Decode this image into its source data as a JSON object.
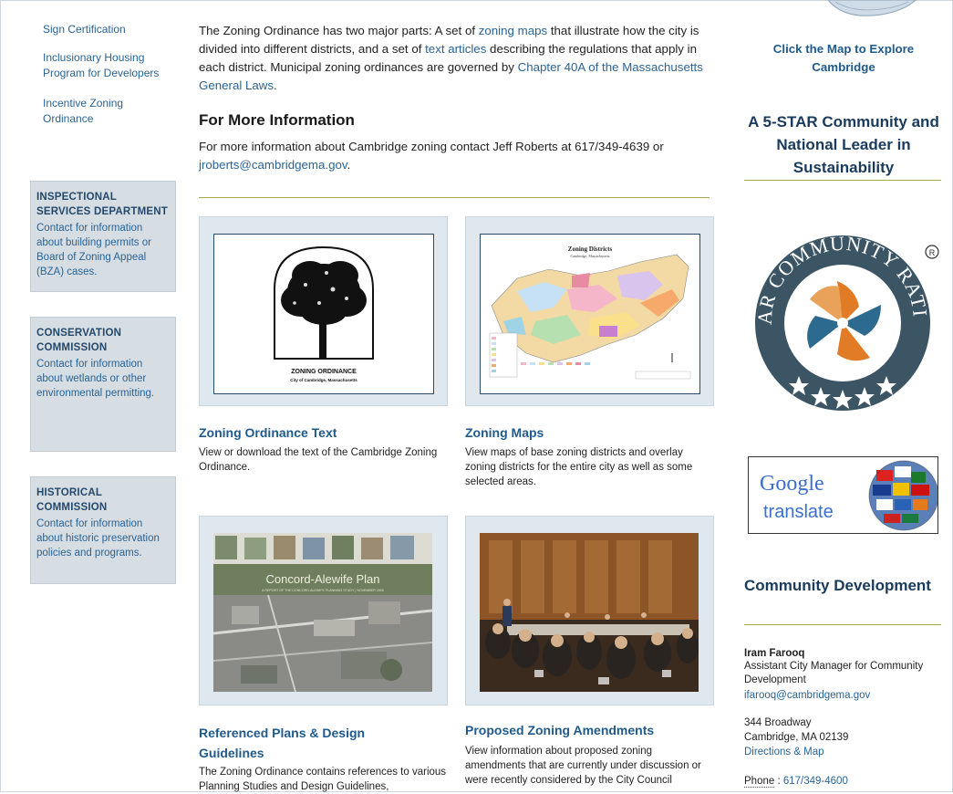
{
  "left_sidebar": {
    "links": [
      "Sign Certification",
      "Inclusionary Housing Program for Developers",
      "Incentive Zoning Ordinance"
    ],
    "boxes": [
      {
        "title": "INSPECTIONAL SERVICES DEPARTMENT",
        "text": "Contact for information about building permits or Board of Zoning Appeal (BZA) cases."
      },
      {
        "title": "CONSERVATION COMMISSION",
        "text": "Contact for information about wetlands or other environmental permitting."
      },
      {
        "title": "HISTORICAL COMMISSION",
        "text": "Contact for information about historic preservation policies and programs."
      }
    ]
  },
  "main": {
    "intro": {
      "t1": "The Zoning Ordinance has two major parts: A set of ",
      "l1": "zoning maps",
      "t2": " that illustrate how the city is divided into different districts, and a set of ",
      "l2": "text articles",
      "t3": " describing the regulations that apply in each district. Municipal zoning ordinances are governed by ",
      "l3": "Chapter 40A of the Massachusetts General Laws",
      "t4": "."
    },
    "more_heading": "For More Information",
    "more": {
      "t1": "For more information about Cambridge zoning contact Jeff Roberts at 617/349-4639 or ",
      "email": "jroberts@cambridgema.gov",
      "t2": "."
    },
    "tiles": [
      {
        "title": "Zoning Ordinance Text",
        "desc": "View or download the text of the Cambridge Zoning Ordinance.",
        "img_caption1": "ZONING ORDINANCE",
        "img_caption2": "City of Cambridge, Massachusetts"
      },
      {
        "title": "Zoning Maps",
        "desc": "View maps of base zoning districts and overlay zoning districts for the entire city as well as some selected areas.",
        "img_caption1": "Zoning Districts",
        "img_caption2": "Cambridge, Massachusetts"
      },
      {
        "title": "Referenced Plans & Design Guidelines",
        "desc": "The Zoning Ordinance contains references to various Planning Studies and Design Guidelines,",
        "img_caption1": "Concord-Alewife Plan",
        "img_caption2": "A REPORT OF THE CONCORD-ALEWIFE PLANNING STUDY | NOVEMBER 2005"
      },
      {
        "title": "Proposed Zoning Amendments",
        "desc": "View information about proposed zoning amendments that are currently under discussion or were recently considered by the City Council"
      }
    ]
  },
  "right": {
    "click_map": "Click the Map to Explore Cambridge",
    "five_star": "A 5-STAR Community and National Leader in Sustainability",
    "star_badge_text": "STAR COMMUNITY RATING",
    "google_word": "Google",
    "translate_word": "translate",
    "cd_heading": "Community Development",
    "contact_name": "Iram Farooq",
    "contact_title": "Assistant City Manager for Community Development",
    "contact_email": "ifarooq@cambridgema.gov",
    "address1": "344 Broadway",
    "address2": "Cambridge, MA 02139",
    "directions": "Directions & Map",
    "phone_label": "Phone",
    "phone_sep": " :  ",
    "phone": "617/349-4600"
  },
  "colors": {
    "link": "#2a6496",
    "heading_blue": "#1f5a8c",
    "divider_olive": "#a6a84a",
    "sidebar_box": "#d6dde3"
  }
}
